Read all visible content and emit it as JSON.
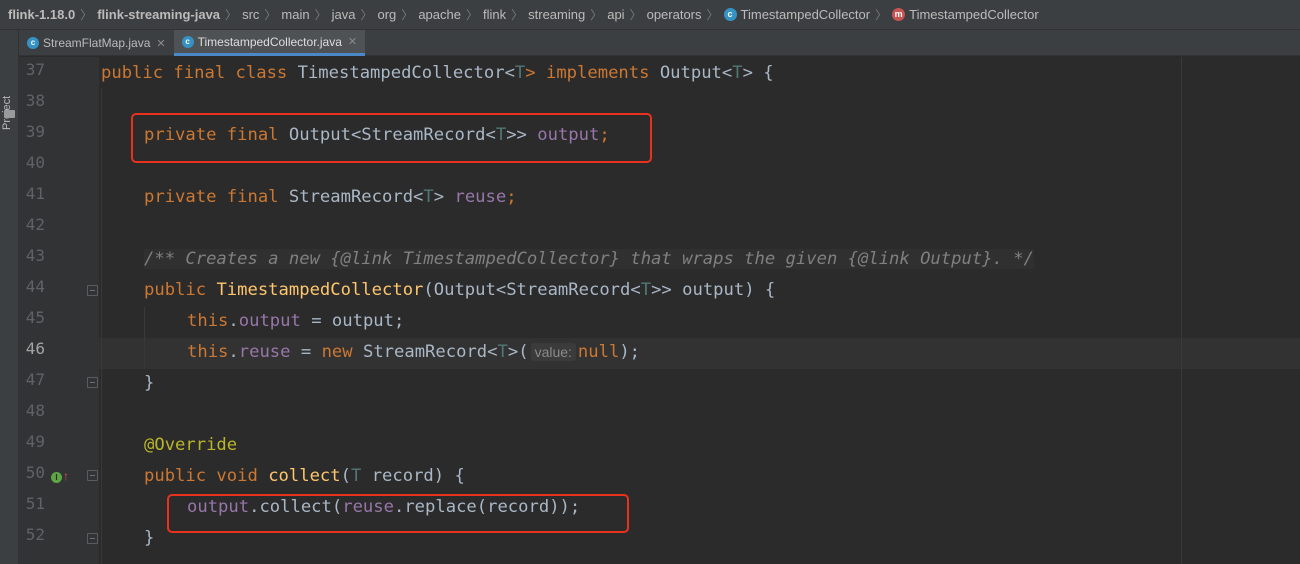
{
  "breadcrumb": [
    "flink-1.18.0",
    "flink-streaming-java",
    "src",
    "main",
    "java",
    "org",
    "apache",
    "flink",
    "streaming",
    "api",
    "operators",
    "TimestampedCollector",
    "TimestampedCollector"
  ],
  "tabs": [
    {
      "label": "StreamFlatMap.java",
      "active": false
    },
    {
      "label": "TimestampedCollector.java",
      "active": true
    }
  ],
  "sidebar": {
    "project_label": "Project"
  },
  "line_numbers": [
    "37",
    "38",
    "39",
    "40",
    "41",
    "42",
    "43",
    "44",
    "45",
    "46",
    "47",
    "48",
    "49",
    "50",
    "51",
    "52"
  ],
  "current_line": "46",
  "code": {
    "l37": {
      "t1": "public final class ",
      "t2": "TimestampedCollector<",
      "t3": "T",
      "t4": "> implements ",
      "t5": "Output<",
      "t6": "T",
      "t7": "> {"
    },
    "l39": {
      "t1": "private final ",
      "t2": "Output<StreamRecord<",
      "t3": "T",
      "t4": ">> ",
      "t5": "output",
      "t6": ";"
    },
    "l41": {
      "t1": "private final ",
      "t2": "StreamRecord<",
      "t3": "T",
      "t4": "> ",
      "t5": "reuse",
      "t6": ";"
    },
    "l43": {
      "t1": "/** Creates a new {@link TimestampedCollector} that wraps the given {@link Output}. */"
    },
    "l44": {
      "t1": "public ",
      "t2": "TimestampedCollector",
      "t3": "(Output<StreamRecord<",
      "t4": "T",
      "t5": ">> output) {"
    },
    "l45": {
      "t1": "this",
      "t2": ".",
      "t3": "output",
      "t4": " = output;"
    },
    "l46": {
      "t1": "this",
      "t2": ".",
      "t3": "reuse",
      "t4": " = ",
      "t5": "new ",
      "t6": "StreamRecord<",
      "t7": "T",
      "t8": ">(",
      "hint": "value:",
      "t9": "null",
      "t10": ");"
    },
    "l47": {
      "t1": "}"
    },
    "l49": {
      "t1": "@Override"
    },
    "l50": {
      "t1": "public void ",
      "t2": "collect",
      "t3": "(",
      "t4": "T",
      "t5": " record) {"
    },
    "l51": {
      "t1": "output",
      "t2": ".collect(",
      "t3": "reuse",
      "t4": ".replace(record));"
    },
    "l52": {
      "t1": "}"
    }
  }
}
